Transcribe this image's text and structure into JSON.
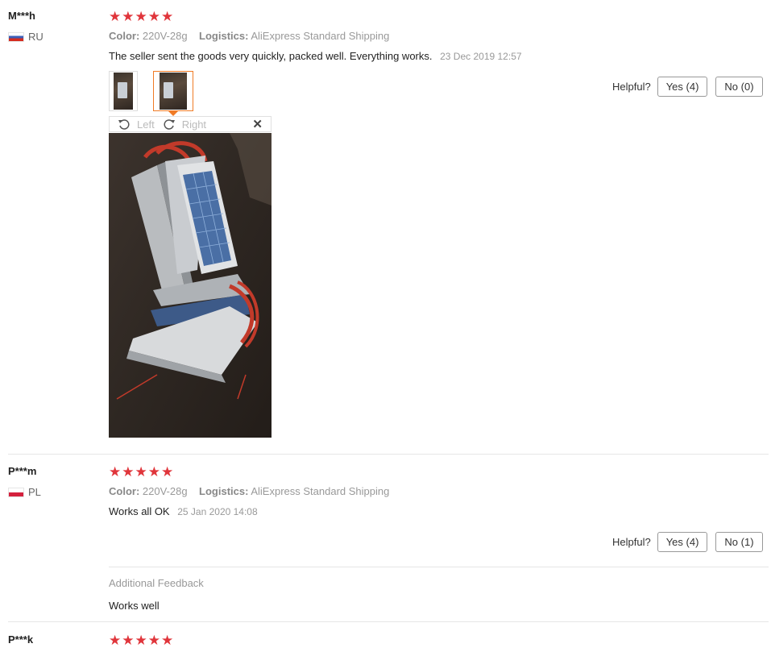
{
  "reviews": [
    {
      "user": "M***h",
      "country": "RU",
      "stars": "★★★★★",
      "color_label": "Color:",
      "color_value": "220V-28g",
      "logistics_label": "Logistics:",
      "logistics_value": "AliExpress Standard Shipping",
      "text": "The seller sent the goods very quickly, packed well. Everything works.",
      "date": "23 Dec 2019 12:57",
      "helpful_label": "Helpful?",
      "yes_label": "Yes (4)",
      "no_label": "No (0)",
      "viewer": {
        "left_label": "Left",
        "right_label": "Right"
      }
    },
    {
      "user": "P***m",
      "country": "PL",
      "stars": "★★★★★",
      "color_label": "Color:",
      "color_value": "220V-28g",
      "logistics_label": "Logistics:",
      "logistics_value": "AliExpress Standard Shipping",
      "text": "Works all OK",
      "date": "25 Jan 2020 14:08",
      "helpful_label": "Helpful?",
      "yes_label": "Yes (4)",
      "no_label": "No (1)",
      "additional_title": "Additional Feedback",
      "additional_text": "Works well"
    },
    {
      "user": "P***k",
      "stars": "★★★★★"
    }
  ],
  "colors": {
    "star": "#e0353b",
    "active_thumb": "#f07b26"
  },
  "icons": {
    "rotate_left": "rotate-left-icon",
    "rotate_right": "rotate-right-icon",
    "close": "close-icon"
  }
}
